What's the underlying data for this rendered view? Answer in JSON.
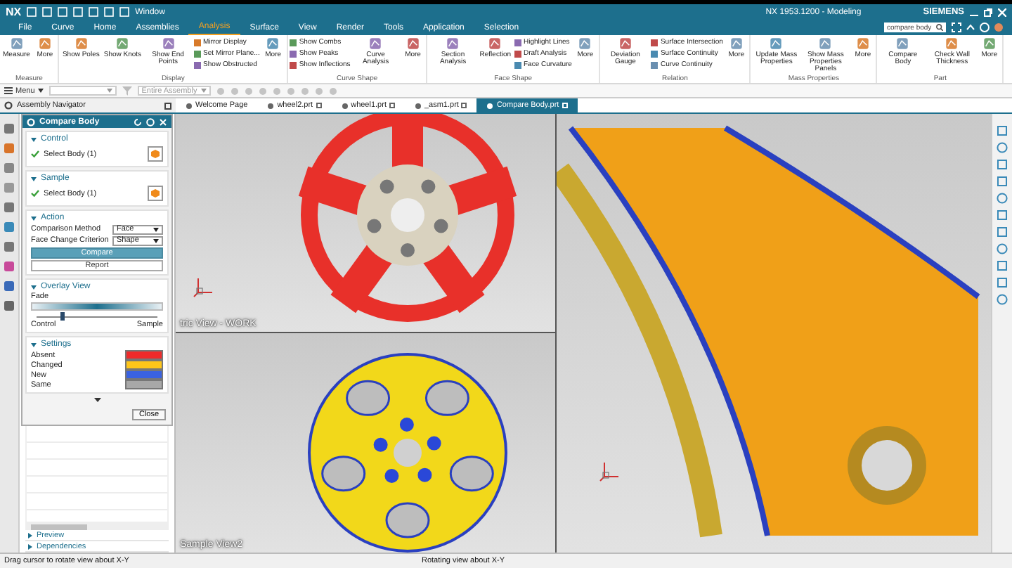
{
  "title_bar": {
    "logo": "NX",
    "window_menu": "Window",
    "title": "NX 1953.1200 - Modeling",
    "brand": "SIEMENS",
    "search_value": "compare body"
  },
  "menu_tabs": [
    {
      "label": "File",
      "selected": false
    },
    {
      "label": "Curve",
      "selected": false
    },
    {
      "label": "Home",
      "selected": false
    },
    {
      "label": "Assemblies",
      "selected": false
    },
    {
      "label": "Analysis",
      "selected": true
    },
    {
      "label": "Surface",
      "selected": false
    },
    {
      "label": "View",
      "selected": false
    },
    {
      "label": "Render",
      "selected": false
    },
    {
      "label": "Tools",
      "selected": false
    },
    {
      "label": "Application",
      "selected": false
    },
    {
      "label": "Selection",
      "selected": false
    }
  ],
  "ribbon": [
    {
      "label": "Measure",
      "tools": [
        {
          "kind": "large",
          "label": "Measure"
        },
        {
          "kind": "large",
          "label": "More"
        }
      ]
    },
    {
      "label": "Display",
      "tools": [
        {
          "kind": "large",
          "label": "Show Poles"
        },
        {
          "kind": "large",
          "label": "Show Knots"
        },
        {
          "kind": "large",
          "label": "Show End Points"
        },
        {
          "kind": "stack",
          "items": [
            "Mirror Display",
            "Set Mirror Plane...",
            "Show Obstructed"
          ]
        },
        {
          "kind": "large",
          "label": "More"
        }
      ]
    },
    {
      "label": "Curve Shape",
      "tools": [
        {
          "kind": "stack",
          "items": [
            "Show Combs",
            "Show Peaks",
            "Show Inflections"
          ]
        },
        {
          "kind": "large",
          "label": "Curve Analysis"
        },
        {
          "kind": "large",
          "label": "More"
        }
      ]
    },
    {
      "label": "Face Shape",
      "tools": [
        {
          "kind": "large",
          "label": "Section Analysis"
        },
        {
          "kind": "large",
          "label": "Reflection"
        },
        {
          "kind": "stack",
          "items": [
            "Highlight Lines",
            "Draft Analysis",
            "Face Curvature"
          ]
        },
        {
          "kind": "large",
          "label": "More"
        }
      ]
    },
    {
      "label": "Relation",
      "tools": [
        {
          "kind": "large",
          "label": "Deviation Gauge"
        },
        {
          "kind": "stack",
          "items": [
            "Surface Intersection",
            "Surface Continuity",
            "Curve Continuity"
          ]
        },
        {
          "kind": "large",
          "label": "More"
        }
      ]
    },
    {
      "label": "Mass Properties",
      "tools": [
        {
          "kind": "large",
          "label": "Update Mass Properties"
        },
        {
          "kind": "large",
          "label": "Show Mass Properties Panels"
        },
        {
          "kind": "large",
          "label": "More"
        }
      ]
    },
    {
      "label": "Part",
      "tools": [
        {
          "kind": "large",
          "label": "Compare Body"
        },
        {
          "kind": "large",
          "label": "Check Wall Thickness"
        },
        {
          "kind": "large",
          "label": "More"
        }
      ]
    }
  ],
  "toolbar": {
    "menu": "Menu",
    "scope": "Entire Assembly"
  },
  "navigator": {
    "title": "Assembly Navigator"
  },
  "doc_tabs": [
    {
      "label": "Welcome Page",
      "selected": false
    },
    {
      "label": "wheel2.prt",
      "selected": false
    },
    {
      "label": "wheel1.prt",
      "selected": false
    },
    {
      "label": "_asm1.prt",
      "selected": false
    },
    {
      "label": "Compare Body.prt",
      "selected": true
    }
  ],
  "dialog": {
    "title": "Compare Body",
    "control": {
      "label": "Control",
      "expanded": true,
      "selection": "Select Body (1)"
    },
    "sample": {
      "label": "Sample",
      "expanded": true,
      "selection": "Select Body (1)"
    },
    "action": {
      "label": "Action",
      "expanded": true,
      "fields": [
        {
          "label": "Comparison Method",
          "value": "Face"
        },
        {
          "label": "Face Change Criterion",
          "value": "Shape"
        }
      ],
      "buttons": [
        {
          "label": "Compare",
          "primary": true
        },
        {
          "label": "Report",
          "primary": false
        }
      ]
    },
    "overlay": {
      "label": "Overlay View",
      "expanded": true,
      "fade_label": "Fade",
      "level": 0.22,
      "min_label": "Control",
      "max_label": "Sample"
    },
    "settings": {
      "label": "Settings",
      "expanded": true,
      "items": [
        {
          "label": "Absent",
          "color": "#ee2b2b"
        },
        {
          "label": "Changed",
          "color": "#ffc61a"
        },
        {
          "label": "New",
          "color": "#3a62e0"
        },
        {
          "label": "Same",
          "color": "#a8a8a8"
        }
      ]
    },
    "close": "Close"
  },
  "navigator_panels": [
    {
      "label": "Preview",
      "expanded": false
    },
    {
      "label": "Dependencies",
      "expanded": false
    }
  ],
  "viewports": [
    {
      "label": "tric View - WORK",
      "kind": "hub-red"
    },
    {
      "label": "Sample View2",
      "kind": "wheel-yellow"
    },
    {
      "kind": "spoke-closeup"
    }
  ],
  "status_bar": {
    "left": "Drag cursor to rotate view about X-Y",
    "right": "Rotating view about X-Y"
  }
}
